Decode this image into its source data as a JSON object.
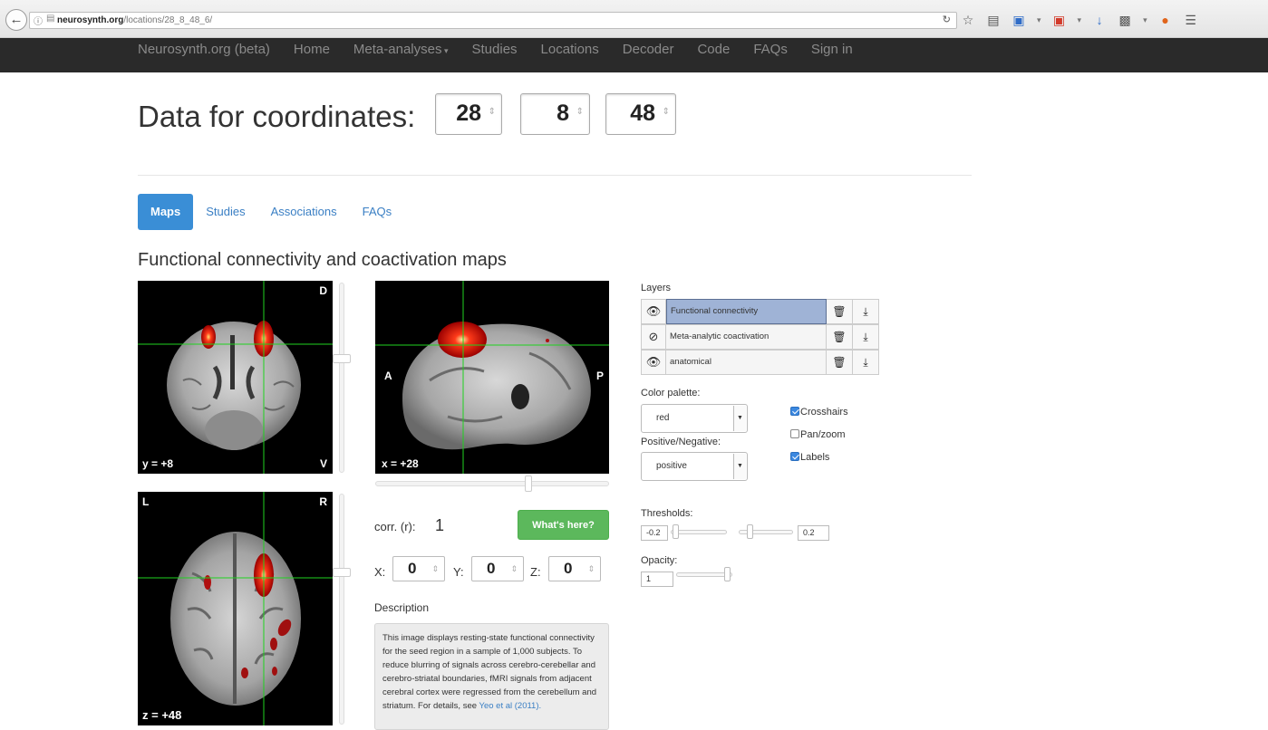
{
  "browser": {
    "url_host": "neurosynth.org",
    "url_path": "/locations/28_8_48_6/"
  },
  "nav": {
    "brand": "Neurosynth.org (beta)",
    "items": [
      "Home",
      "Meta-analyses",
      "Studies",
      "Locations",
      "Decoder",
      "Code",
      "FAQs",
      "Sign in"
    ]
  },
  "header": {
    "title": "Data for coordinates:",
    "coords": [
      "28",
      "8",
      "48"
    ]
  },
  "tabs": [
    "Maps",
    "Studies",
    "Associations",
    "FAQs"
  ],
  "section_title": "Functional connectivity and coactivation maps",
  "viewer": {
    "coronal": {
      "label_top": "D",
      "label_bottom_left": "y = +8",
      "label_bottom_right": "V"
    },
    "sagittal": {
      "label_left": "A",
      "label_right": "P",
      "label_bottom_left": "x = +28"
    },
    "axial": {
      "label_top_left": "L",
      "label_top_right": "R",
      "label_bottom_left": "z = +48"
    }
  },
  "controls": {
    "corr_label": "corr. (r):",
    "corr_value": "1",
    "whats_here": "What's here?",
    "x_label": "X:",
    "y_label": "Y:",
    "z_label": "Z:",
    "x_value": "0",
    "y_value": "0",
    "z_value": "0",
    "description_title": "Description",
    "description_text": "This image displays resting-state functional connectivity for the seed region in a sample of 1,000 subjects. To reduce blurring of signals across cerebro-cerebellar and cerebro-striatal boundaries, fMRI signals from adjacent cerebral cortex were regressed from the cerebellum and striatum. For details, see",
    "description_link": "Yeo et al (2011)."
  },
  "layers": {
    "title": "Layers",
    "items": [
      "Functional connectivity",
      "Meta-analytic coactivation",
      "anatomical"
    ]
  },
  "palette": {
    "color_label": "Color palette:",
    "color_value": "red",
    "sign_label": "Positive/Negative:",
    "sign_value": "positive",
    "crosshairs": "Crosshairs",
    "panzoom": "Pan/zoom",
    "labels": "Labels",
    "crosshairs_checked": true,
    "panzoom_checked": false,
    "labels_checked": true
  },
  "thresholds": {
    "label": "Thresholds:",
    "neg": "-0.2",
    "pos": "0.2"
  },
  "opacity": {
    "label": "Opacity:",
    "value": "1"
  }
}
